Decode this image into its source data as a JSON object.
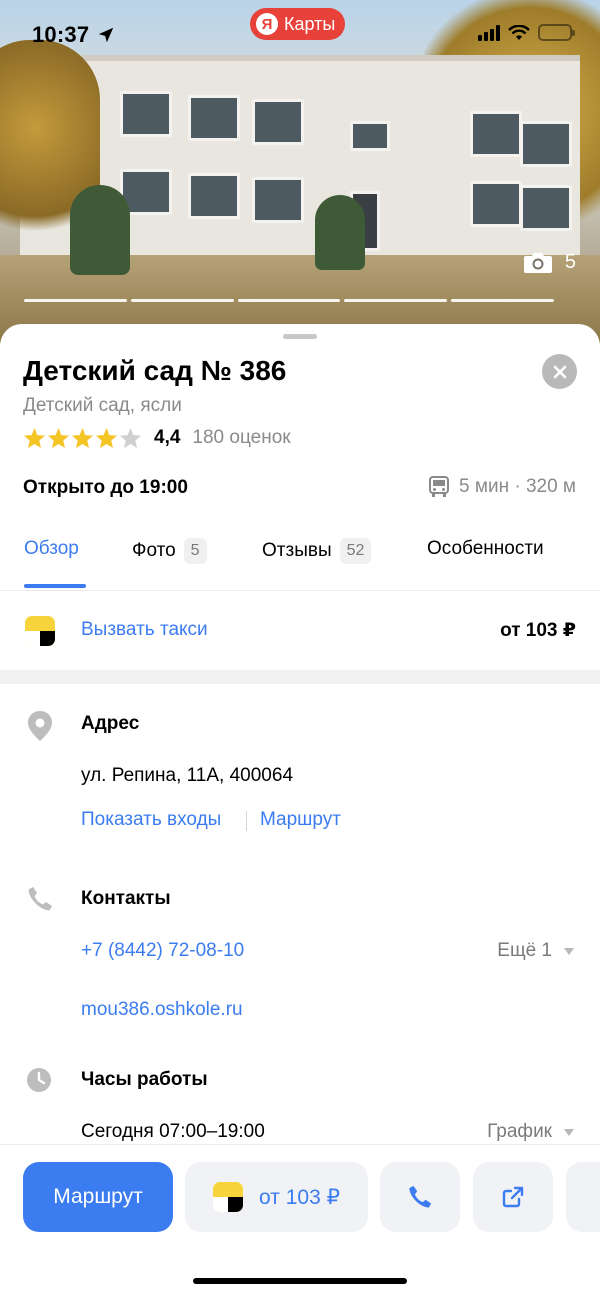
{
  "status_bar": {
    "time": "10:37",
    "app_name": "Карты",
    "app_logo_letter": "Я"
  },
  "photo": {
    "count": "5",
    "segments": 5
  },
  "place": {
    "title": "Детский сад № 386",
    "category": "Детский сад, ясли",
    "rating": "4,4",
    "stars_filled": 4,
    "stars_total": 5,
    "reviews_count_text": "180 оценок",
    "open_status": "Открыто до 19:00",
    "transit_text": "5 мин · 320 м"
  },
  "tabs": [
    {
      "label": "Обзор",
      "count": ""
    },
    {
      "label": "Фото",
      "count": "5"
    },
    {
      "label": "Отзывы",
      "count": "52"
    },
    {
      "label": "Особенности",
      "count": ""
    }
  ],
  "taxi": {
    "label": "Вызвать такси",
    "price": "от 103 ₽"
  },
  "address": {
    "title": "Адрес",
    "value": "ул. Репина, 11А, 400064",
    "show_entrances": "Показать входы",
    "route": "Маршрут"
  },
  "contacts": {
    "title": "Контакты",
    "phone": "+7 (8442) 72-08-10",
    "more": "Ещё 1",
    "website": "mou386.oshkole.ru"
  },
  "hours": {
    "title": "Часы работы",
    "today": "Сегодня 07:00–19:00",
    "schedule": "График"
  },
  "bottom_bar": {
    "route_label": "Маршрут",
    "taxi_price": "от 103 ₽"
  },
  "colors": {
    "accent": "#3b7cf0",
    "star": "#f5c526",
    "brand_red": "#e8413a",
    "taxi_yellow": "#f7d43b"
  }
}
